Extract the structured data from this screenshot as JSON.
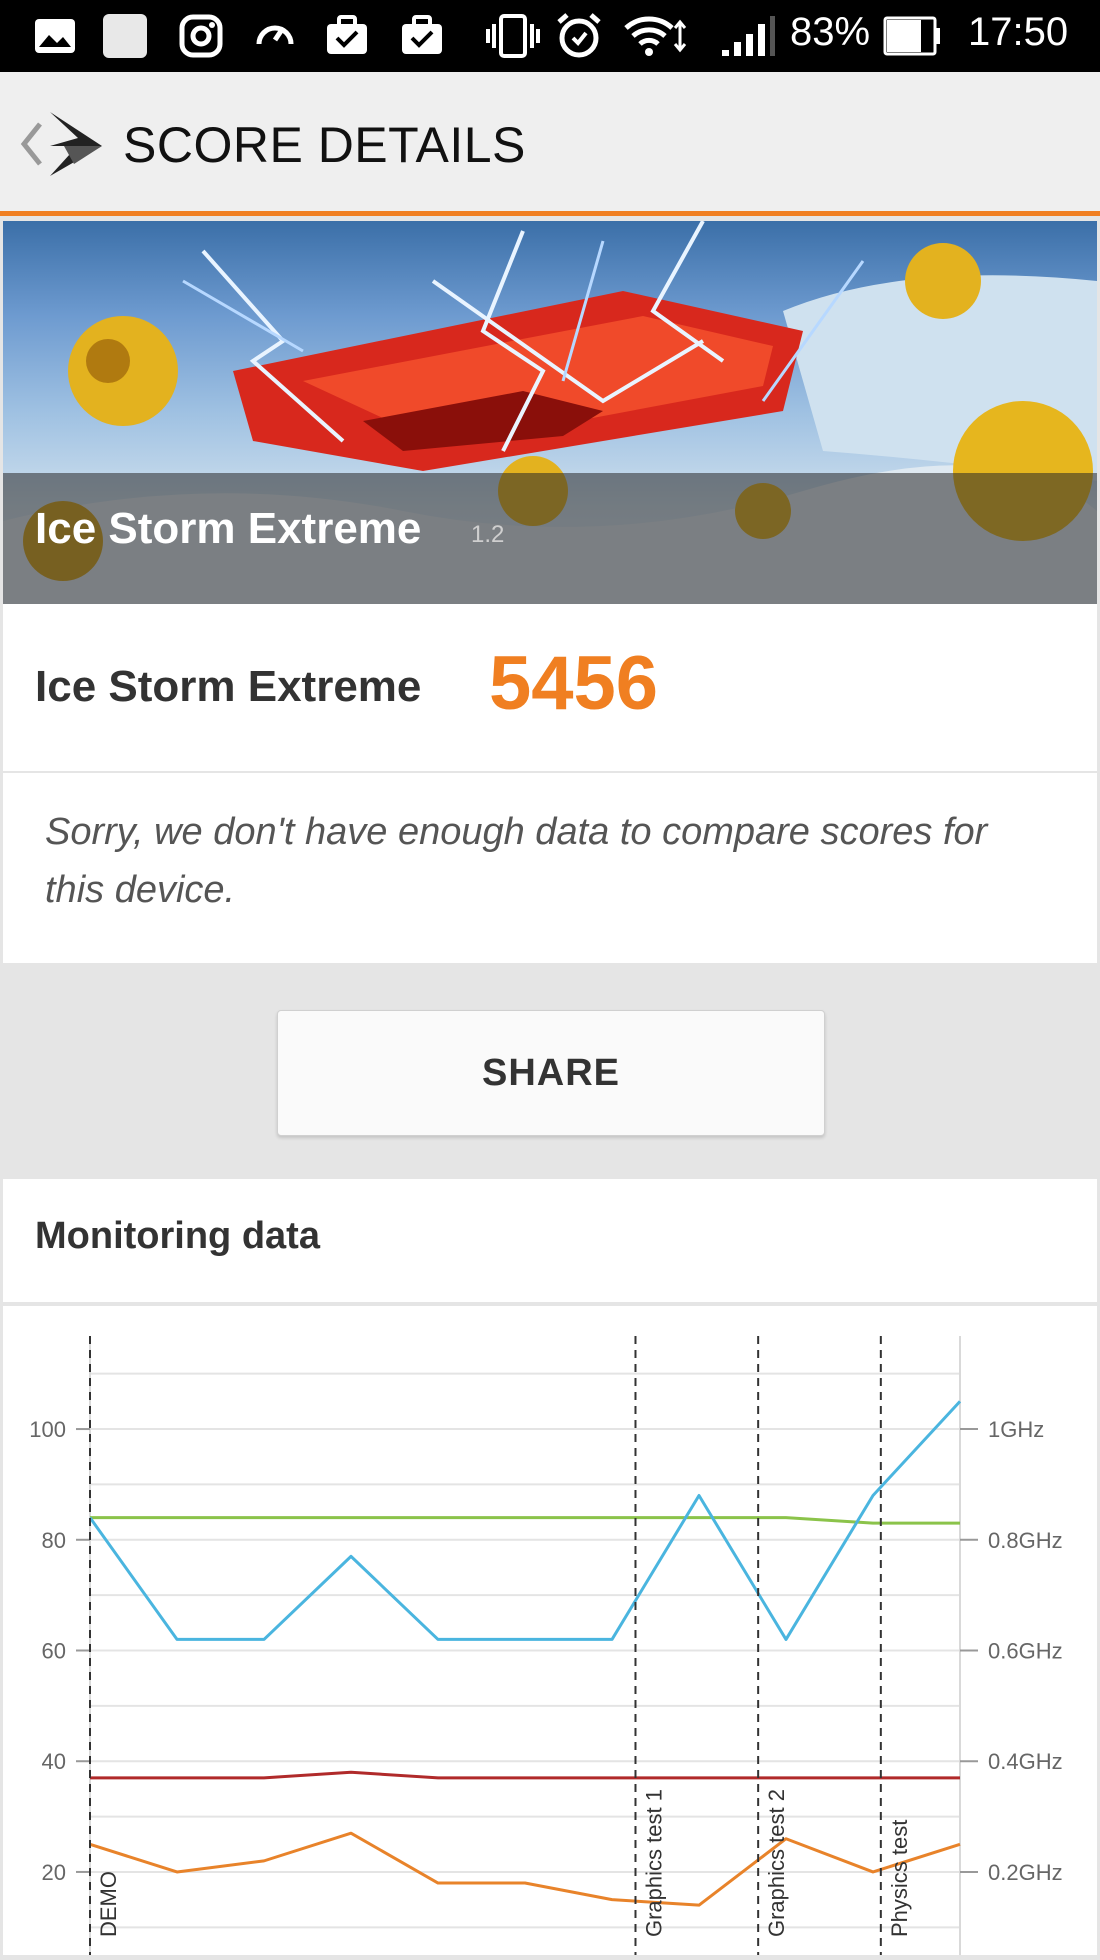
{
  "status_bar": {
    "battery": "83%",
    "time": "17:50",
    "icons": [
      "photo-icon",
      "blank-square-icon",
      "instagram-icon",
      "speed-icon",
      "briefcase-check-icon",
      "briefcase-check-icon",
      "vibrate-icon",
      "alarm-icon",
      "wifi-icon",
      "signal-icon",
      "battery-icon"
    ]
  },
  "app_bar": {
    "title": "SCORE DETAILS"
  },
  "banner": {
    "title": "Ice Storm Extreme",
    "version": "1.2"
  },
  "score": {
    "name": "Ice Storm Extreme",
    "value": "5456"
  },
  "compare_message": "Sorry, we don't have enough data to compare scores for this device.",
  "share": {
    "label": "SHARE"
  },
  "monitoring": {
    "title": "Monitoring data"
  },
  "colors": {
    "accent": "#f07f21",
    "cpu_freq": "#4ab5df",
    "battery": "#8bc34a",
    "temp": "#b02a2a",
    "fps": "#e8832a"
  },
  "chart_data": {
    "type": "line",
    "title": "",
    "left_axis": {
      "ticks": [
        "20",
        "40",
        "60",
        "80",
        "100"
      ],
      "ylim": [
        5,
        115
      ]
    },
    "right_axis": {
      "ticks": [
        "0.2GHz",
        "0.4GHz",
        "0.6GHz",
        "0.8GHz",
        "1GHz"
      ]
    },
    "x": [
      0,
      0.1,
      0.2,
      0.3,
      0.4,
      0.5,
      0.6,
      0.7,
      0.8,
      0.9,
      1
    ],
    "xlim": [
      0,
      1
    ],
    "markers": [
      {
        "label": "DEMO",
        "x": 0
      },
      {
        "label": "Graphics test 1",
        "x": 0.627
      },
      {
        "label": "Graphics test 2",
        "x": 0.768
      },
      {
        "label": "Physics test",
        "x": 0.909
      }
    ],
    "series": [
      {
        "color": "#8bc34a",
        "values": [
          84,
          84,
          84,
          84,
          84,
          84,
          84,
          84,
          84,
          83,
          83
        ]
      },
      {
        "color": "#4ab5df",
        "values": [
          84,
          62,
          62,
          77,
          62,
          62,
          62,
          88,
          62,
          88,
          105
        ]
      },
      {
        "color": "#b02a2a",
        "values": [
          37,
          37,
          37,
          38,
          37,
          37,
          37,
          37,
          37,
          37,
          37
        ]
      },
      {
        "color": "#e8832a",
        "values": [
          25,
          20,
          22,
          27,
          18,
          18,
          15,
          14,
          26,
          20,
          25
        ]
      }
    ]
  }
}
